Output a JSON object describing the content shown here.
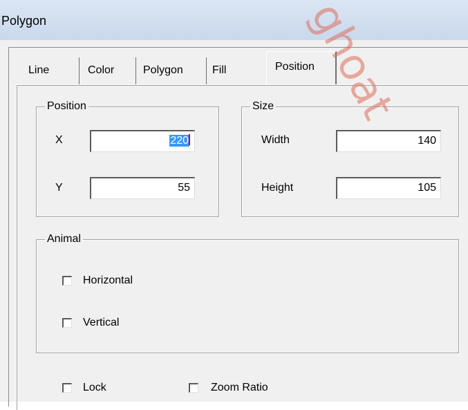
{
  "window": {
    "title": "Polygon"
  },
  "tabs": [
    {
      "label": "Line",
      "active": false
    },
    {
      "label": "Color",
      "active": false
    },
    {
      "label": "Polygon",
      "active": false
    },
    {
      "label": "Fill",
      "active": false
    },
    {
      "label": "Position",
      "active": true
    }
  ],
  "position_group": {
    "title": "Position",
    "x_label": "X",
    "x_value": "220",
    "y_label": "Y",
    "y_value": "55"
  },
  "size_group": {
    "title": "Size",
    "width_label": "Width",
    "width_value": "140",
    "height_label": "Height",
    "height_value": "105"
  },
  "animal_group": {
    "title": "Animal",
    "horizontal_label": "Horizontal",
    "horizontal_checked": false,
    "vertical_label": "Vertical",
    "vertical_checked": false
  },
  "options": {
    "lock_label": "Lock",
    "lock_checked": false,
    "zoom_ratio_label": "Zoom Ratio",
    "zoom_ratio_checked": false
  },
  "watermark": {
    "text": "ghoat",
    "color": "#dc6e5a"
  }
}
